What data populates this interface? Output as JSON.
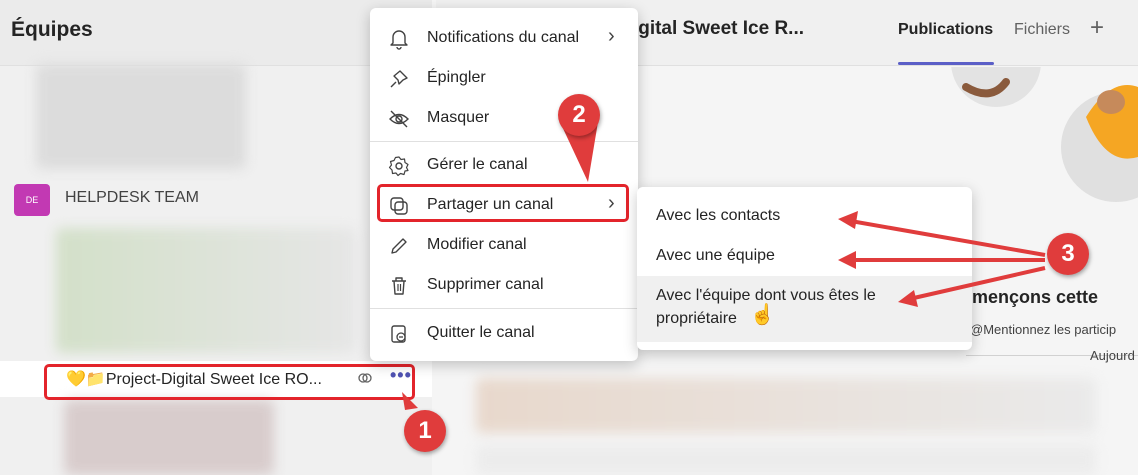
{
  "left_pane": {
    "title": "Équipes",
    "team": {
      "avatar_initials": "DE",
      "name": "HELPDESK TEAM"
    },
    "channel": {
      "emoji": "💛📁",
      "name": "Project-Digital Sweet Ice RO...",
      "more_label": "•••"
    }
  },
  "right_pane": {
    "channel_title": "ct-Digital Sweet Ice R...",
    "tabs": [
      {
        "label": "Publications",
        "active": true
      },
      {
        "label": "Fichiers",
        "active": false
      }
    ],
    "add_tab": "+",
    "welcome_heading": "mmençons cette",
    "mention_hint": "@Mentionnez les particip",
    "date_label": "Aujourd"
  },
  "context_menu": {
    "items": [
      {
        "label": "Notifications du canal",
        "icon": "bell-icon",
        "has_submenu": true
      },
      {
        "label": "Épingler",
        "icon": "pin-icon",
        "has_submenu": false
      },
      {
        "label": "Masquer",
        "icon": "eye-off-icon",
        "has_submenu": false
      },
      {
        "label": "Gérer le canal",
        "icon": "gear-icon",
        "has_submenu": false
      },
      {
        "label": "Partager un canal",
        "icon": "share-channel-icon",
        "has_submenu": true
      },
      {
        "label": "Modifier canal",
        "icon": "pencil-icon",
        "has_submenu": false
      },
      {
        "label": "Supprimer canal",
        "icon": "trash-icon",
        "has_submenu": false
      },
      {
        "label": "Quitter le canal",
        "icon": "leave-icon",
        "has_submenu": false
      }
    ]
  },
  "share_submenu": {
    "items": [
      {
        "label": "Avec les contacts"
      },
      {
        "label": "Avec une équipe"
      },
      {
        "label": "Avec l'équipe dont vous êtes le propriétaire"
      }
    ]
  },
  "annotations": {
    "badge_1": "1",
    "badge_2": "2",
    "badge_3": "3",
    "color": "#e03c3c"
  },
  "colors": {
    "accent": "#5b5fc7",
    "highlight": "#e3242b",
    "avatar": "#c239b3"
  }
}
